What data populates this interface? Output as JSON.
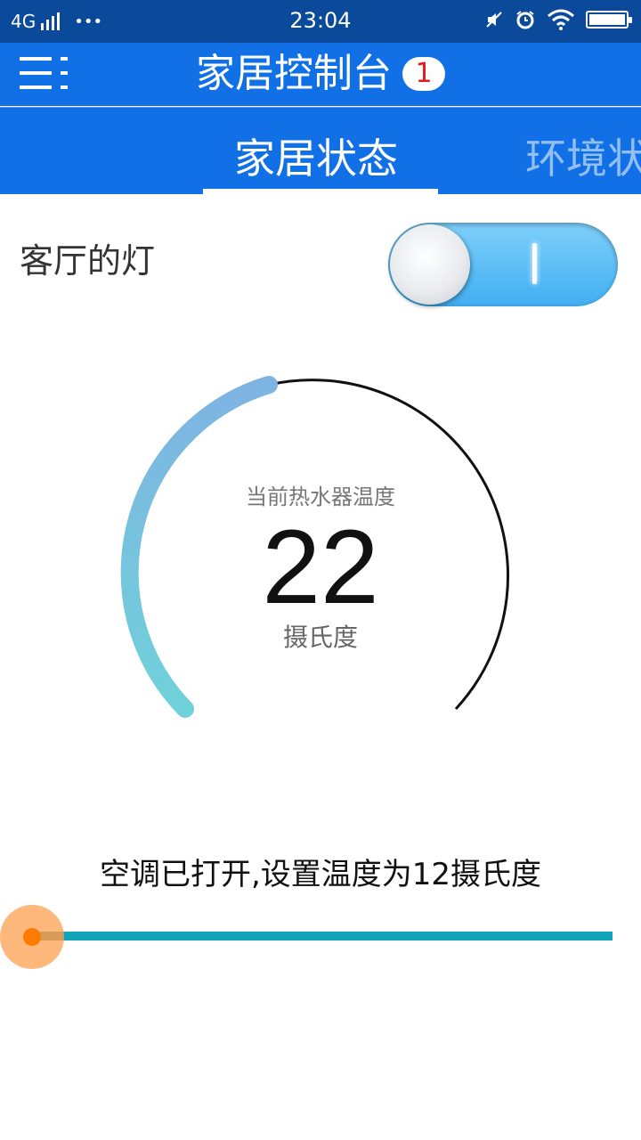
{
  "status_bar": {
    "network": "4G",
    "more": "•••",
    "time": "23:04"
  },
  "app_bar": {
    "title": "家居控制台",
    "badge_count": "1"
  },
  "tabs": [
    {
      "label": "家居状态",
      "active": true
    },
    {
      "label": "环境状",
      "active": false
    }
  ],
  "living_room_light": {
    "label": "客厅的灯",
    "on": true,
    "mark": "|"
  },
  "water_heater": {
    "caption": "当前热水器温度",
    "value": "22",
    "unit": "摄氏度"
  },
  "air_conditioner": {
    "status_text": "空调已打开,设置温度为12摄氏度",
    "slider_level": 0.0
  },
  "colors": {
    "status_bar": "#0b4a9a",
    "app_bar": "#1170e6",
    "gauge_arc_start": "#6fd1d9",
    "gauge_arc_end": "#7eb4e2",
    "slider_track": "#12a4b8",
    "slider_thumb": "#ff7a00",
    "badge_text": "#e11b1b"
  }
}
